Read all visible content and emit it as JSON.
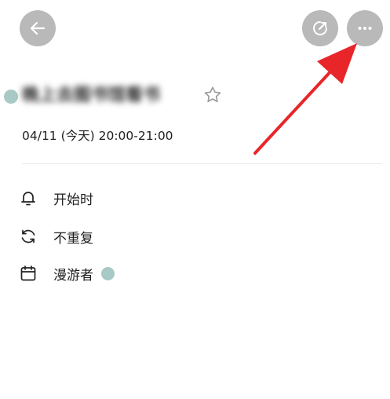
{
  "header": {
    "back_icon": "arrow-left-icon",
    "share_icon": "external-share-icon",
    "more_icon": "more-horizontal-icon"
  },
  "event": {
    "title": "晚上去图书馆看书",
    "time": "04/11 (今天) 20:00-21:00",
    "star_icon": "star-outline-icon"
  },
  "details": {
    "reminder": {
      "icon": "bell-icon",
      "label": "开始时"
    },
    "repeat": {
      "icon": "repeat-icon",
      "label": "不重复"
    },
    "calendar": {
      "icon": "calendar-icon",
      "label": "漫游者"
    }
  },
  "colors": {
    "calendar": "#a8c9c6",
    "button_bg": "#b9b9b9",
    "annotation_arrow": "#e8262a"
  }
}
